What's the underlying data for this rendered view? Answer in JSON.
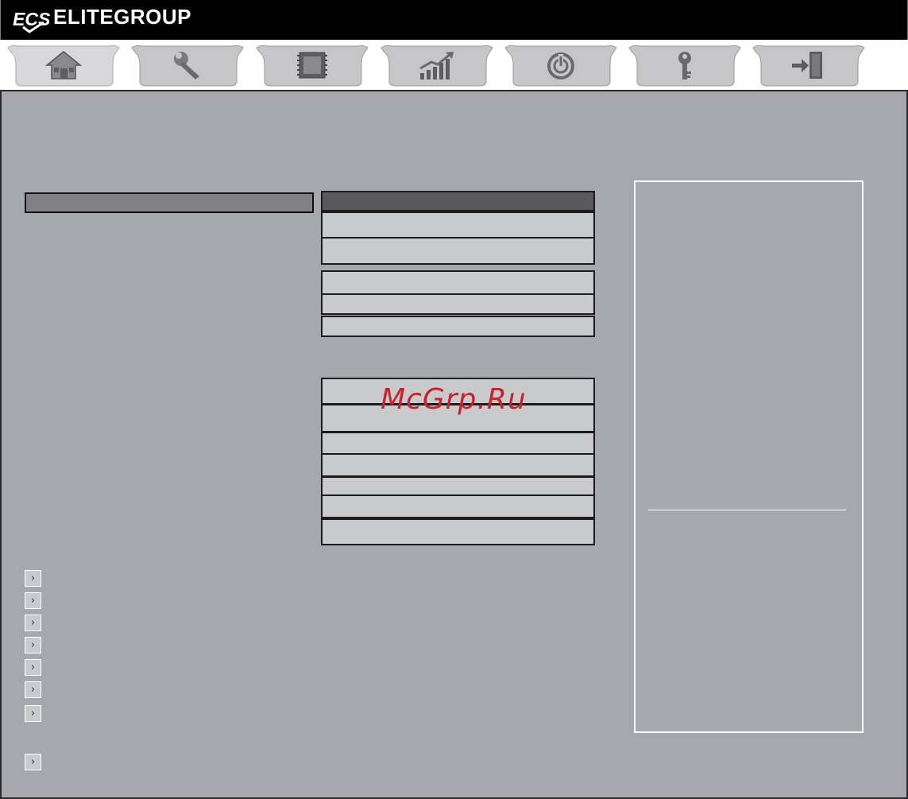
{
  "header": {
    "brand_name": "ELITEGROUP",
    "logo_text": "ECS"
  },
  "tabs": [
    {
      "icon": "home-icon",
      "active": true
    },
    {
      "icon": "wrench-icon",
      "active": false
    },
    {
      "icon": "chip-icon",
      "active": false
    },
    {
      "icon": "performance-chart-icon",
      "active": false
    },
    {
      "icon": "power-icon",
      "active": false
    },
    {
      "icon": "key-icon",
      "active": false
    },
    {
      "icon": "exit-icon",
      "active": false
    }
  ],
  "submenu_arrows": [
    "›",
    "›",
    "›",
    "›",
    "›",
    "›",
    "›",
    "›"
  ],
  "watermark": "McGrp.Ru",
  "colors": {
    "background": "#a7a8ad",
    "field": "#c9cacc",
    "field_dark": "#59595b",
    "header_bar": "#000000",
    "watermark": "#c8232c"
  }
}
